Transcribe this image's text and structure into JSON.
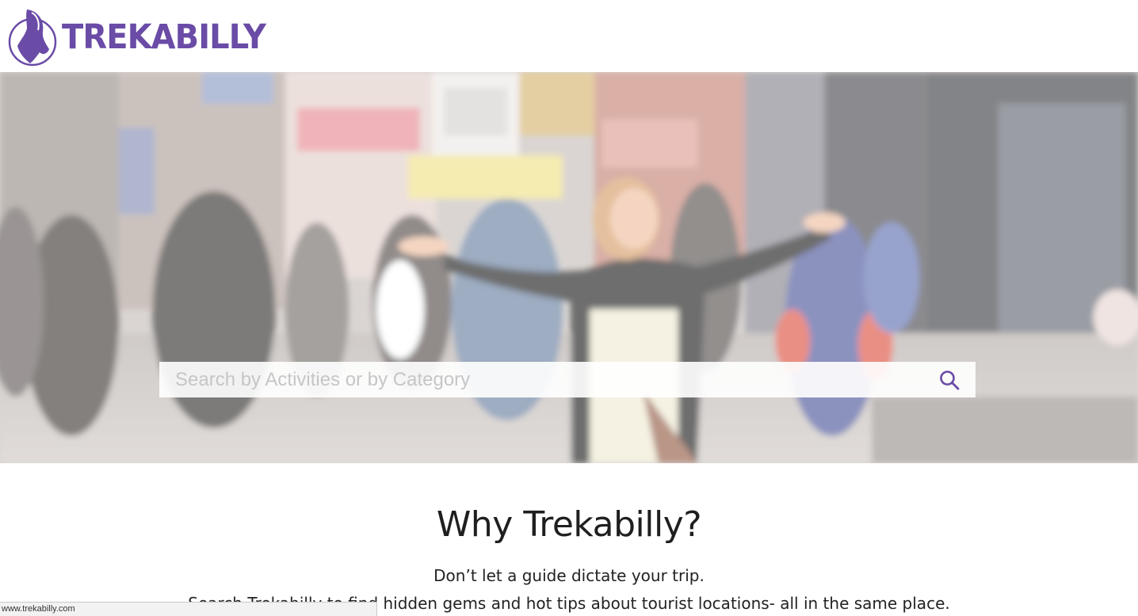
{
  "brand": {
    "name": "TREKABILLY",
    "color": "#6a4ba6"
  },
  "hero": {
    "search": {
      "placeholder": "Search by Activities or by Category",
      "icon": "search-icon"
    }
  },
  "why": {
    "title": "Why Trekabilly?",
    "line1": "Don’t let a guide dictate your trip.",
    "line2": "Search Trekabilly to find hidden gems and hot tips about tourist locations- all in the same place."
  },
  "status_bar": {
    "url": "www.trekabilly.com"
  }
}
